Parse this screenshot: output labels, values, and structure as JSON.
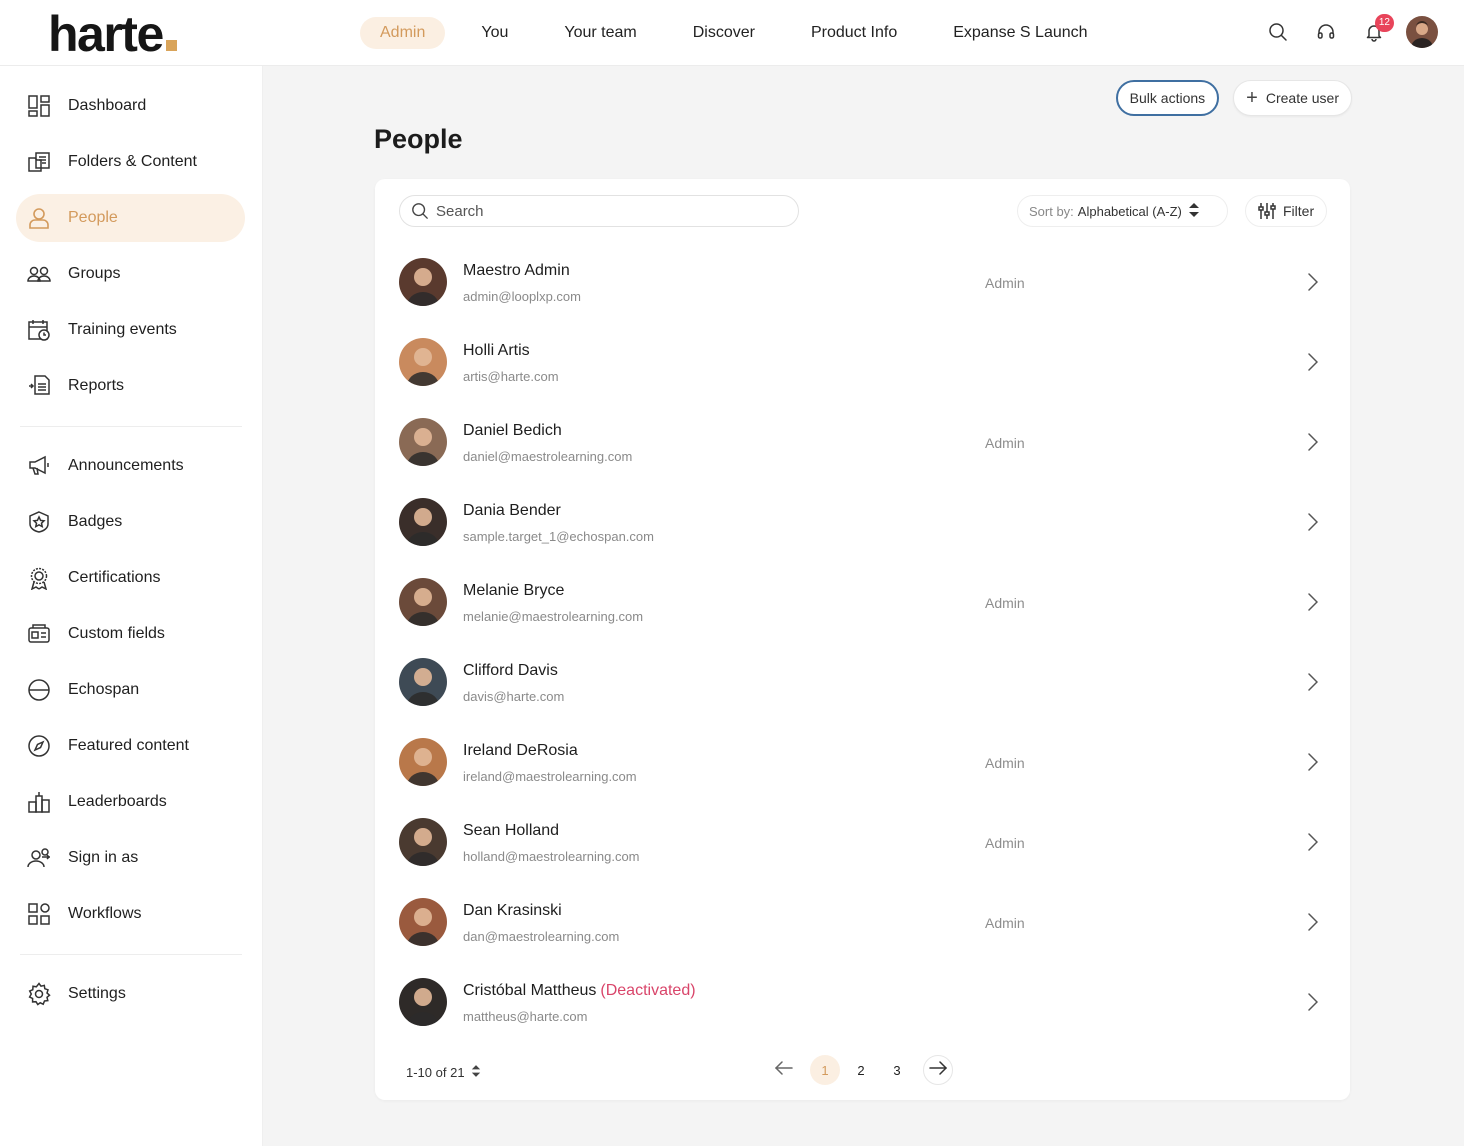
{
  "brand": {
    "name": "harte",
    "accent": "#d9a45a"
  },
  "topnav": {
    "tabs": [
      {
        "label": "Admin",
        "active": true
      },
      {
        "label": "You",
        "active": false
      },
      {
        "label": "Your team",
        "active": false
      },
      {
        "label": "Discover",
        "active": false
      },
      {
        "label": "Product Info",
        "active": false
      },
      {
        "label": "Expanse S Launch",
        "active": false
      }
    ],
    "icons": [
      "search-icon",
      "headset-icon",
      "bell-icon",
      "user-avatar"
    ],
    "notification_count": "12"
  },
  "sidebar": {
    "items": [
      {
        "label": "Dashboard",
        "icon": "dashboard-icon",
        "active": false
      },
      {
        "label": "Folders & Content",
        "icon": "folders-icon",
        "active": false
      },
      {
        "label": "People",
        "icon": "person-icon",
        "active": true
      },
      {
        "label": "Groups",
        "icon": "groups-icon",
        "active": false
      },
      {
        "label": "Training events",
        "icon": "calendar-clock-icon",
        "active": false
      },
      {
        "label": "Reports",
        "icon": "reports-icon",
        "active": false
      },
      {
        "label": "Announcements",
        "icon": "megaphone-icon",
        "active": false
      },
      {
        "label": "Badges",
        "icon": "badge-icon",
        "active": false
      },
      {
        "label": "Certifications",
        "icon": "certificate-icon",
        "active": false
      },
      {
        "label": "Custom fields",
        "icon": "custom-fields-icon",
        "active": false
      },
      {
        "label": "Echospan",
        "icon": "echospan-icon",
        "active": false
      },
      {
        "label": "Featured content",
        "icon": "compass-icon",
        "active": false
      },
      {
        "label": "Leaderboards",
        "icon": "leaderboard-icon",
        "active": false
      },
      {
        "label": "Sign in as",
        "icon": "sign-in-as-icon",
        "active": false
      },
      {
        "label": "Workflows",
        "icon": "workflows-icon",
        "active": false
      },
      {
        "label": "Settings",
        "icon": "gear-icon",
        "active": false
      }
    ]
  },
  "actions": {
    "bulk_label": "Bulk actions",
    "create_label": "Create user"
  },
  "page": {
    "title": "People"
  },
  "toolbar": {
    "search_placeholder": "Search",
    "sort_label": "Sort by:",
    "sort_value": "Alphabetical (A-Z)",
    "filter_label": "Filter"
  },
  "people": [
    {
      "name": "Maestro Admin",
      "email": "admin@looplxp.com",
      "role": "Admin",
      "deactivated": "",
      "avatar_color": "#5a3a2e"
    },
    {
      "name": "Holli Artis",
      "email": "artis@harte.com",
      "role": "",
      "deactivated": "",
      "avatar_color": "#c98a5e"
    },
    {
      "name": "Daniel Bedich",
      "email": "daniel@maestrolearning.com",
      "role": "Admin",
      "deactivated": "",
      "avatar_color": "#8a6a55"
    },
    {
      "name": "Dania Bender",
      "email": "sample.target_1@echospan.com",
      "role": "",
      "deactivated": "",
      "avatar_color": "#3a2e2a"
    },
    {
      "name": "Melanie Bryce",
      "email": "melanie@maestrolearning.com",
      "role": "Admin",
      "deactivated": "",
      "avatar_color": "#6b4a3a"
    },
    {
      "name": "Clifford Davis",
      "email": "davis@harte.com",
      "role": "",
      "deactivated": "",
      "avatar_color": "#3e4a55"
    },
    {
      "name": "Ireland DeRosia",
      "email": "ireland@maestrolearning.com",
      "role": "Admin",
      "deactivated": "",
      "avatar_color": "#b9784a"
    },
    {
      "name": "Sean Holland",
      "email": "holland@maestrolearning.com",
      "role": "Admin",
      "deactivated": "",
      "avatar_color": "#4a3a30"
    },
    {
      "name": "Dan Krasinski",
      "email": "dan@maestrolearning.com",
      "role": "Admin",
      "deactivated": "",
      "avatar_color": "#9a5a3e"
    },
    {
      "name": "Cristóbal Mattheus",
      "email": "mattheus@harte.com",
      "role": "",
      "deactivated": "(Deactivated)",
      "avatar_color": "#2e2a28"
    }
  ],
  "pagination": {
    "range_label": "1-10 of 21",
    "pages": [
      "1",
      "2",
      "3"
    ],
    "current": "1"
  }
}
